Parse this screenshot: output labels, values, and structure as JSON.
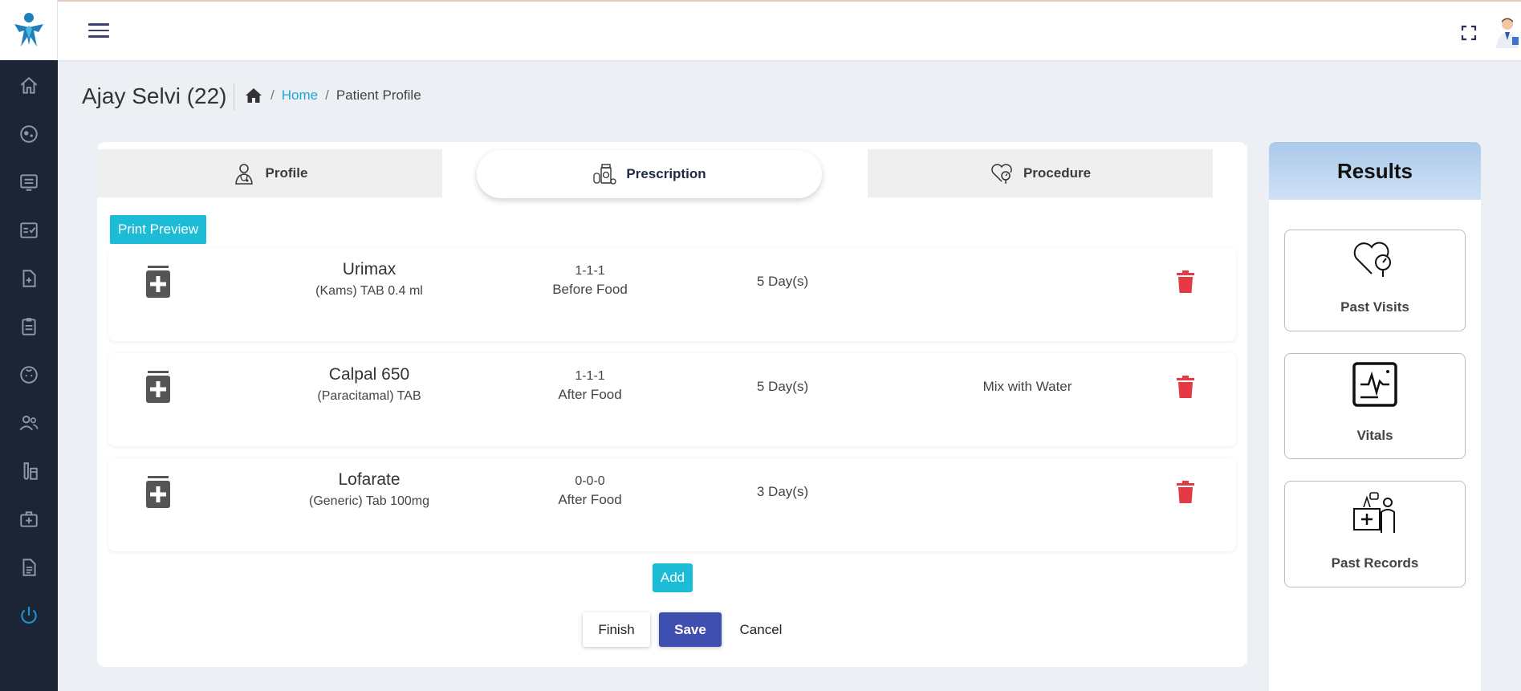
{
  "sidebar": {
    "logo": "medical-star-logo",
    "items": [
      {
        "icon": "home-icon"
      },
      {
        "icon": "patient-face-icon"
      },
      {
        "icon": "monitor-list-icon"
      },
      {
        "icon": "checklist-icon"
      },
      {
        "icon": "file-add-icon"
      },
      {
        "icon": "clipboard-icon"
      },
      {
        "icon": "baby-face-icon"
      },
      {
        "icon": "users-icon"
      },
      {
        "icon": "vials-icon"
      },
      {
        "icon": "medical-kit-icon"
      },
      {
        "icon": "document-icon"
      },
      {
        "icon": "power-icon"
      }
    ]
  },
  "header": {
    "title": "Ajay Selvi (22)",
    "breadcrumb": {
      "home": "Home",
      "current": "Patient Profile",
      "separator": "/"
    }
  },
  "tabs": [
    {
      "label": "Profile",
      "icon": "doctor-icon",
      "active": false
    },
    {
      "label": "Prescription",
      "icon": "medicine-bottle-icon",
      "active": true
    },
    {
      "label": "Procedure",
      "icon": "heart-stethoscope-icon",
      "active": false
    }
  ],
  "print_preview_label": "Print Preview",
  "prescriptions": [
    {
      "name": "Urimax",
      "description": "(Kams) TAB 0.4 ml",
      "dosage": "1-1-1",
      "timing": "Before Food",
      "duration": "5 Day(s)",
      "note": ""
    },
    {
      "name": "Calpal 650",
      "description": "(Paracitamal) TAB",
      "dosage": "1-1-1",
      "timing": "After Food",
      "duration": "5 Day(s)",
      "note": "Mix with Water"
    },
    {
      "name": "Lofarate",
      "description": "(Generic) Tab 100mg",
      "dosage": "0-0-0",
      "timing": "After Food",
      "duration": "3 Day(s)",
      "note": ""
    }
  ],
  "actions": {
    "add": "Add",
    "finish": "Finish",
    "save": "Save",
    "cancel": "Cancel"
  },
  "results": {
    "title": "Results",
    "cards": [
      {
        "label": "Past Visits",
        "icon": "heart-stethoscope-icon"
      },
      {
        "label": "Vitals",
        "icon": "vitals-chart-icon"
      },
      {
        "label": "Past Records",
        "icon": "doctor-records-icon"
      }
    ]
  },
  "colors": {
    "sidebar": "#1b2535",
    "accent": "#1cbcd6",
    "primary": "#3f4fb0",
    "danger": "#e53946",
    "link": "#1fa8d6"
  }
}
